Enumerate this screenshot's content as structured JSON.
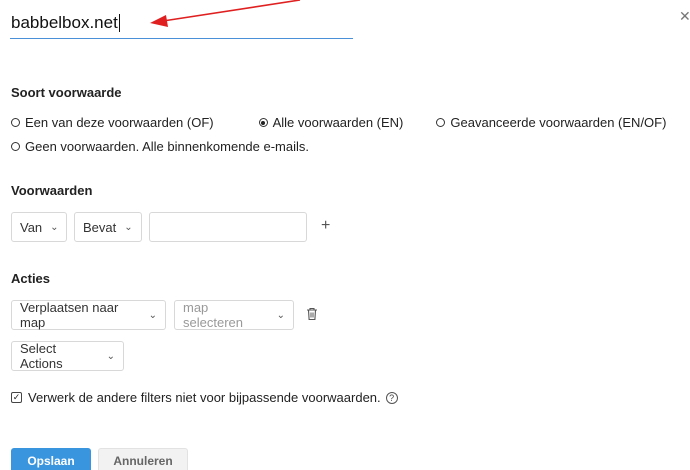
{
  "filter_name": {
    "value": "babbelbox.net"
  },
  "condition_type": {
    "title": "Soort voorwaarde",
    "options": [
      {
        "label": "Een van deze voorwaarden (OF)",
        "checked": false
      },
      {
        "label": "Alle voorwaarden (EN)",
        "checked": true
      },
      {
        "label": "Geavanceerde voorwaarden (EN/OF)",
        "checked": false
      },
      {
        "label": "Geen voorwaarden. Alle binnenkomende e-mails.",
        "checked": false
      }
    ]
  },
  "conditions": {
    "title": "Voorwaarden",
    "field_select": "Van",
    "operator_select": "Bevat",
    "value": ""
  },
  "actions": {
    "title": "Acties",
    "action_select": "Verplaatsen naar map",
    "folder_select": "map selecteren",
    "extra_select": "Select Actions"
  },
  "stop_processing": {
    "label": "Verwerk de andere filters niet voor bijpassende voorwaarden.",
    "checked": true
  },
  "buttons": {
    "save": "Opslaan",
    "cancel": "Annuleren"
  },
  "colors": {
    "accent": "#3a95df",
    "arrow": "#e02020",
    "underline": "#4a90d9"
  },
  "icons": {
    "close": "close-icon",
    "chevron": "chevron-down-icon",
    "plus": "plus-icon",
    "trash": "trash-icon",
    "help": "help-icon",
    "arrow": "annotation-arrow-icon"
  }
}
